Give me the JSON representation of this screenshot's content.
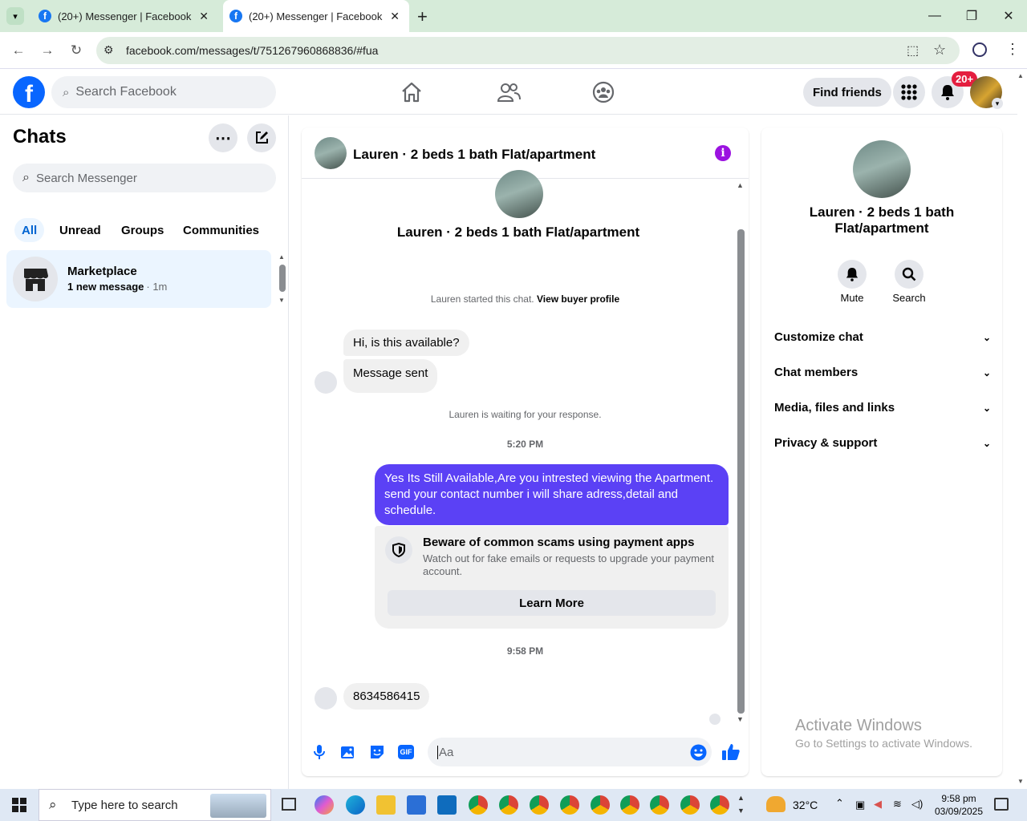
{
  "browser": {
    "tabs": [
      {
        "title": "(20+) Messenger | Facebook"
      },
      {
        "title": "(20+) Messenger | Facebook"
      }
    ],
    "url": "facebook.com/messages/t/751267960868836/#fua"
  },
  "header": {
    "search_placeholder": "Search Facebook",
    "find_friends": "Find friends",
    "notif_badge": "20+"
  },
  "sidebar": {
    "title": "Chats",
    "search_placeholder": "Search Messenger",
    "filters": [
      "All",
      "Unread",
      "Groups",
      "Communities"
    ],
    "chat": {
      "name": "Marketplace",
      "preview": "1 new message",
      "time": "· 1m"
    }
  },
  "conversation": {
    "title": "Lauren · 2 beds 1 bath Flat/apartment",
    "intro_name": "Lauren · 2 beds 1 bath Flat/apartment",
    "started_text": "Lauren started this chat.",
    "view_profile": "View buyer profile",
    "msg1": "Hi, is this available?",
    "msg2": "Message sent",
    "waiting": "Lauren is waiting for your response.",
    "time1": "5:20 PM",
    "outgoing": "Yes Its Still Available,Are you intrested viewing the Apartment. send your contact number i will share adress,detail and schedule.",
    "scam_title": "Beware of common scams using payment apps",
    "scam_body": "Watch out for fake emails or requests to upgrade your payment account.",
    "learn_more": "Learn More",
    "time2": "9:58 PM",
    "msg3": "8634586415",
    "composer_placeholder": "Aa"
  },
  "details": {
    "name_line1": "Lauren · 2 beds 1 bath",
    "name_line2": "Flat/apartment",
    "mute": "Mute",
    "search": "Search",
    "sections": [
      "Customize chat",
      "Chat members",
      "Media, files and links",
      "Privacy & support"
    ]
  },
  "watermark": {
    "line1": "Activate Windows",
    "line2": "Go to Settings to activate Windows."
  },
  "taskbar": {
    "search_placeholder": "Type here to search",
    "temp": "32°C",
    "time": "9:58 pm",
    "date": "03/09/2025"
  },
  "colors": {
    "accent": "#0866ff",
    "outgoing_bubble": "#5b41f5",
    "info_icon": "#9b12e0"
  }
}
